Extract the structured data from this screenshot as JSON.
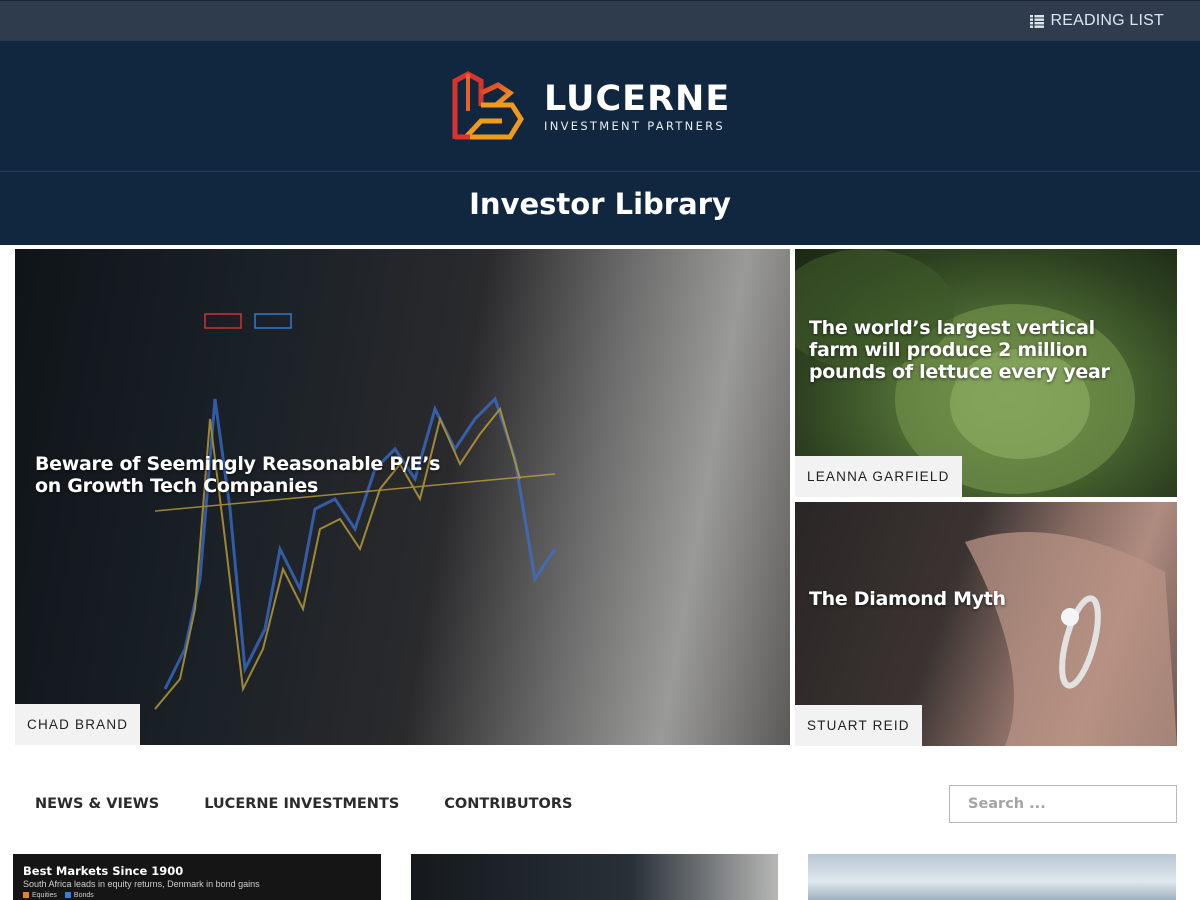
{
  "topbar": {
    "reading_list_label": "READING LIST",
    "reading_list_icon": "list-icon"
  },
  "header": {
    "logo_name": "LUCERNE",
    "logo_sub": "INVESTMENT PARTNERS",
    "page_title": "Investor Library",
    "colors": {
      "bg": "#10273f",
      "topbar": "#2f3c4e",
      "logo_red": "#d9342b",
      "logo_orange": "#f29a1f"
    }
  },
  "featured": [
    {
      "title": "Beware of Seemingly Reasonable P/E’s on Growth Tech Companies",
      "author": "CHAD BRAND"
    },
    {
      "title": "The world’s largest vertical farm will produce 2 million pounds of lettuce every year",
      "author": "LEANNA GARFIELD"
    },
    {
      "title": "The Diamond Myth",
      "author": "STUART REID"
    }
  ],
  "nav": {
    "items": [
      "NEWS & VIEWS",
      "LUCERNE INVESTMENTS",
      "CONTRIBUTORS"
    ],
    "search_placeholder": "Search ..."
  },
  "cards": [
    {
      "title": "Best Markets Since 1900",
      "subtitle": "South Africa leads in equity returns, Denmark in bond gains",
      "legend": [
        "Equities",
        "Bonds"
      ],
      "legend_colors": [
        "#e8832a",
        "#3a7bd5"
      ]
    }
  ]
}
